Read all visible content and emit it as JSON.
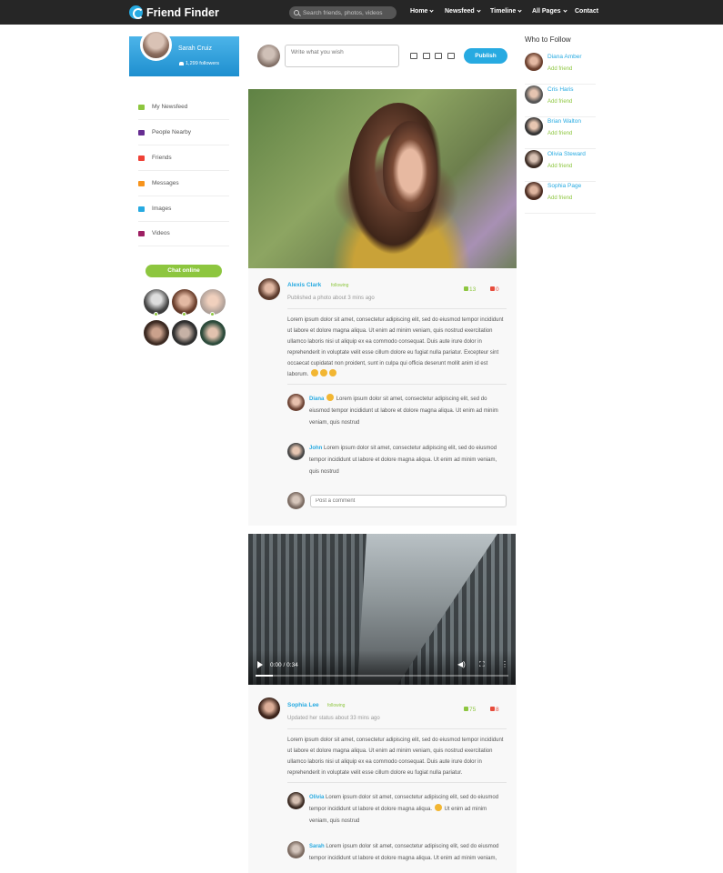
{
  "header": {
    "logo_text": "Friend Finder",
    "search_placeholder": "Search friends, photos, videos",
    "nav": [
      "Home",
      "Newsfeed",
      "Timeline",
      "All Pages",
      "Contact"
    ]
  },
  "profile": {
    "name": "Sarah Cruiz",
    "followers": "1,299 followers"
  },
  "sidebar": {
    "items": [
      {
        "label": "My Newsfeed",
        "icon": "newsfeed-icon",
        "color": "#8dc63f"
      },
      {
        "label": "People Nearby",
        "icon": "people-icon",
        "color": "#662d91"
      },
      {
        "label": "Friends",
        "icon": "friends-icon",
        "color": "#ef4136"
      },
      {
        "label": "Messages",
        "icon": "messages-icon",
        "color": "#f7941d"
      },
      {
        "label": "Images",
        "icon": "images-icon",
        "color": "#27aae1"
      },
      {
        "label": "Videos",
        "icon": "videos-icon",
        "color": "#9e1f63"
      }
    ],
    "chat_label": "Chat online"
  },
  "composer": {
    "placeholder": "Write what you wish",
    "publish_label": "Publish"
  },
  "posts": [
    {
      "author": "Alexis Clark",
      "following": "following",
      "meta": "Published a photo about 3 mins ago",
      "likes": "13",
      "dislikes": "0",
      "body": "Lorem ipsum dolor sit amet, consectetur adipiscing elit, sed do eiusmod tempor incididunt ut labore et dolore magna aliqua. Ut enim ad minim veniam, quis nostrud exercitation ullamco laboris nisi ut aliquip ex ea commodo consequat. Duis aute irure dolor in reprehenderit in voluptate velit esse cillum dolore eu fugiat nulla pariatur. Excepteur sint occaecat cupidatat non proident, sunt in culpa qui officia deserunt mollit anim id est laborum.",
      "comments": [
        {
          "name": "Diana",
          "text": "Lorem ipsum dolor sit amet, consectetur adipiscing elit, sed do eiusmod tempor incididunt ut labore et dolore magna aliqua. Ut enim ad minim veniam, quis nostrud"
        },
        {
          "name": "John",
          "text": "Lorem ipsum dolor sit amet, consectetur adipiscing elit, sed do eiusmod tempor incididunt ut labore et dolore magna aliqua. Ut enim ad minim veniam, quis nostrud"
        }
      ],
      "comment_placeholder": "Post a comment"
    },
    {
      "video_time": "0:00 / 0:34",
      "video_progress": 0.07,
      "author": "Sophia Lee",
      "following": "following",
      "meta": "Updated her status about 33 mins ago",
      "likes": "75",
      "dislikes": "8",
      "body": "Lorem ipsum dolor sit amet, consectetur adipiscing elit, sed do eiusmod tempor incididunt ut labore et dolore magna aliqua. Ut enim ad minim veniam, quis nostrud exercitation ullamco laboris nisi ut aliquip ex ea commodo consequat. Duis aute irure dolor in reprehenderit in voluptate velit esse cillum dolore eu fugiat nulla pariatur.",
      "comments": [
        {
          "name": "Olivia",
          "text_a": "Lorem ipsum dolor sit amet, consectetur adipiscing elit, sed do eiusmod tempor incididunt ut labore et dolore magna aliqua.",
          "text_b": "Ut enim ad minim veniam, quis nostrud"
        },
        {
          "name": "Sarah",
          "text": "Lorem ipsum dolor sit amet, consectetur adipiscing elit, sed do eiusmod tempor incididunt ut labore et dolore magna aliqua. Ut enim ad minim veniam,"
        }
      ]
    }
  ],
  "who_to_follow": {
    "title": "Who to Follow",
    "people": [
      {
        "name": "Diana Amber",
        "action": "Add friend"
      },
      {
        "name": "Cris Haris",
        "action": "Add friend"
      },
      {
        "name": "Brian Walton",
        "action": "Add friend"
      },
      {
        "name": "Olivia Steward",
        "action": "Add friend"
      },
      {
        "name": "Sophia Page",
        "action": "Add friend"
      }
    ]
  },
  "colors": {
    "brand": "#27aae1",
    "accent_green": "#8dc63f",
    "dislike_red": "#e74c3c",
    "topbar": "#262626"
  }
}
